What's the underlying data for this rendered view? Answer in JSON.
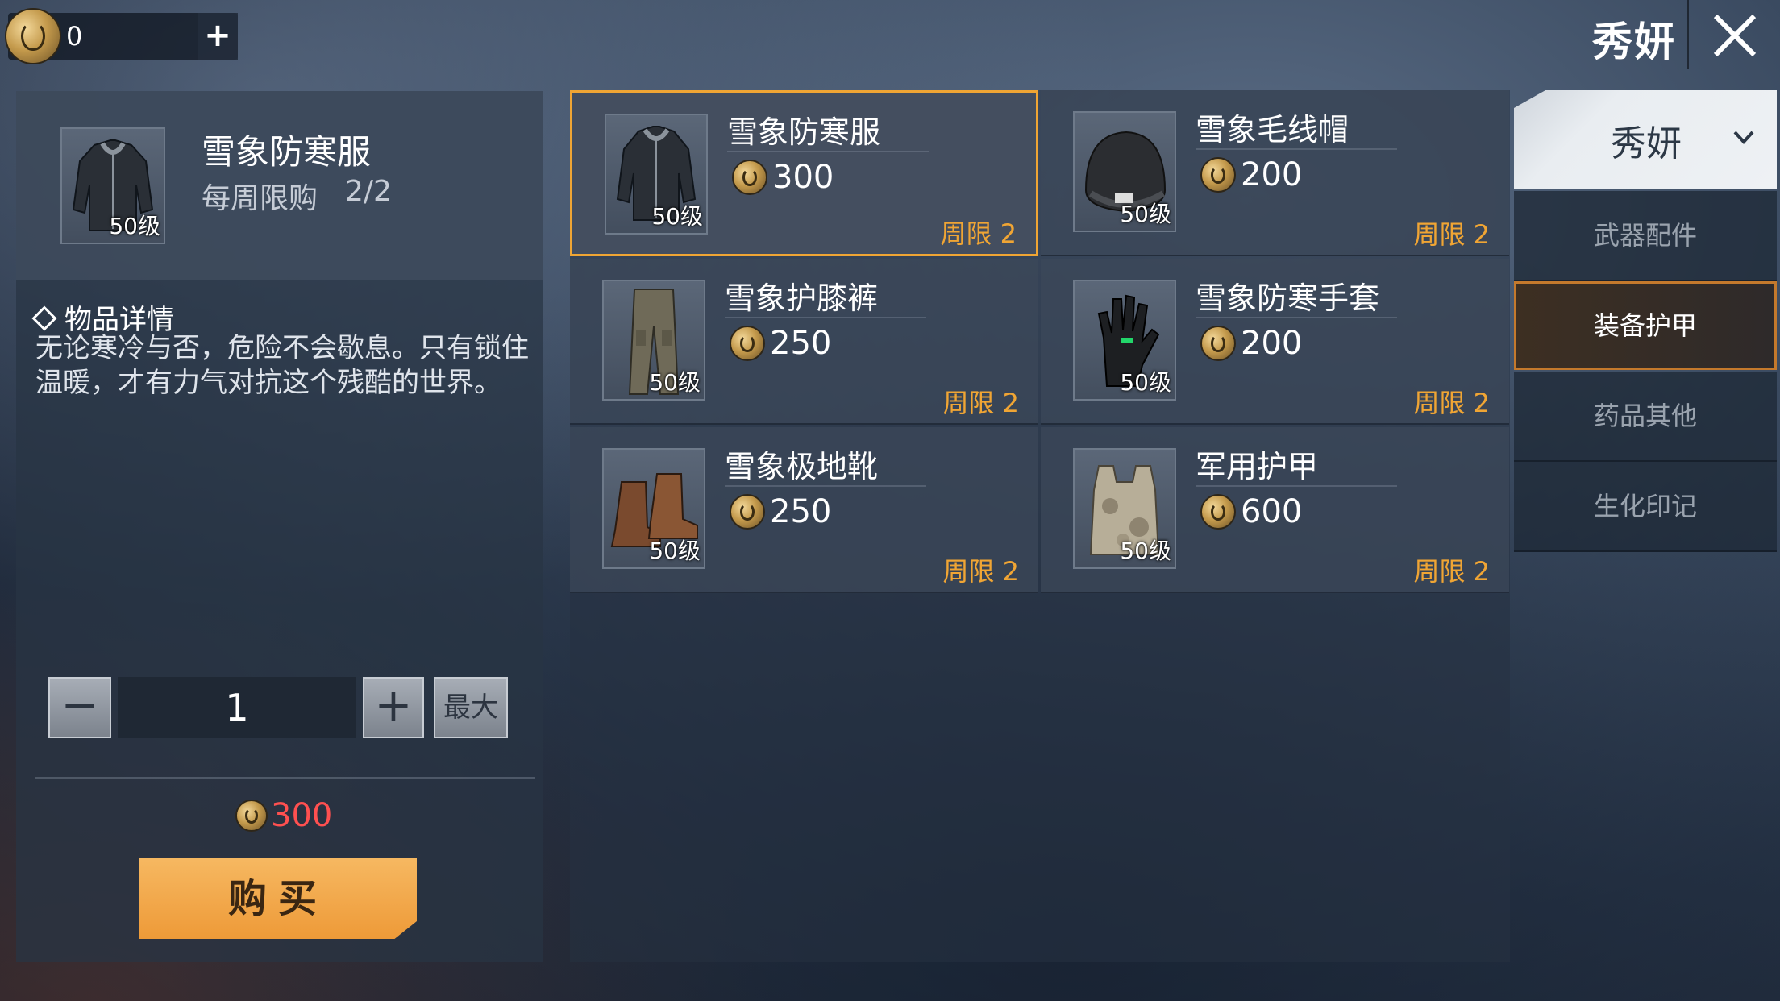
{
  "currency": {
    "value": "0",
    "add_label": "+"
  },
  "top": {
    "title": "秀妍"
  },
  "detail": {
    "item_name": "雪象防寒服",
    "limit_label": "每周限购",
    "limit_value": "2/2",
    "level": "50级",
    "heading": "物品详情",
    "description": "无论寒冷与否，危险不会歇息。只有锁住温暖，才有力气对抗这个残酷的世界。",
    "quantity": "1",
    "minus_label": "−",
    "plus_label": "+",
    "max_label": "最大",
    "total_price": "300",
    "buy_label": "购买"
  },
  "items": [
    {
      "name": "雪象防寒服",
      "price": "300",
      "level": "50级",
      "limit": "周限 2",
      "icon": "jacket-icon"
    },
    {
      "name": "雪象毛线帽",
      "price": "200",
      "level": "50级",
      "limit": "周限 2",
      "icon": "beanie-icon"
    },
    {
      "name": "雪象护膝裤",
      "price": "250",
      "level": "50级",
      "limit": "周限 2",
      "icon": "pants-icon"
    },
    {
      "name": "雪象防寒手套",
      "price": "200",
      "level": "50级",
      "limit": "周限 2",
      "icon": "gloves-icon"
    },
    {
      "name": "雪象极地靴",
      "price": "250",
      "level": "50级",
      "limit": "周限 2",
      "icon": "boots-icon"
    },
    {
      "name": "军用护甲",
      "price": "600",
      "level": "50级",
      "limit": "周限 2",
      "icon": "armor-vest-icon"
    }
  ],
  "sidebar": {
    "dropdown_label": "秀妍",
    "tabs": [
      {
        "label": "武器配件",
        "active": false
      },
      {
        "label": "装备护甲",
        "active": true
      },
      {
        "label": "药品其他",
        "active": false
      },
      {
        "label": "生化印记",
        "active": false
      }
    ]
  },
  "colors": {
    "accent": "#f0a534",
    "price_red": "#ff5050",
    "buy_button": "#f0a33f"
  }
}
